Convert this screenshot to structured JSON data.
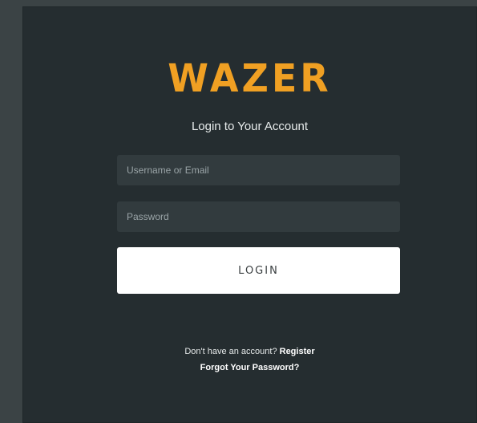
{
  "brand": {
    "logo_text": "WAZER",
    "subtitle": "Login to Your Account"
  },
  "form": {
    "username_placeholder": "Username or Email",
    "password_placeholder": "Password",
    "login_label": "LOGIN"
  },
  "footer": {
    "no_account_text": "Don't have an account? ",
    "register_label": "Register",
    "forgot_label": "Forgot Your Password?"
  },
  "colors": {
    "brand_orange": "#f0a023",
    "panel_bg": "#252d30",
    "field_bg": "#323b3e",
    "button_bg": "#ffffff"
  }
}
